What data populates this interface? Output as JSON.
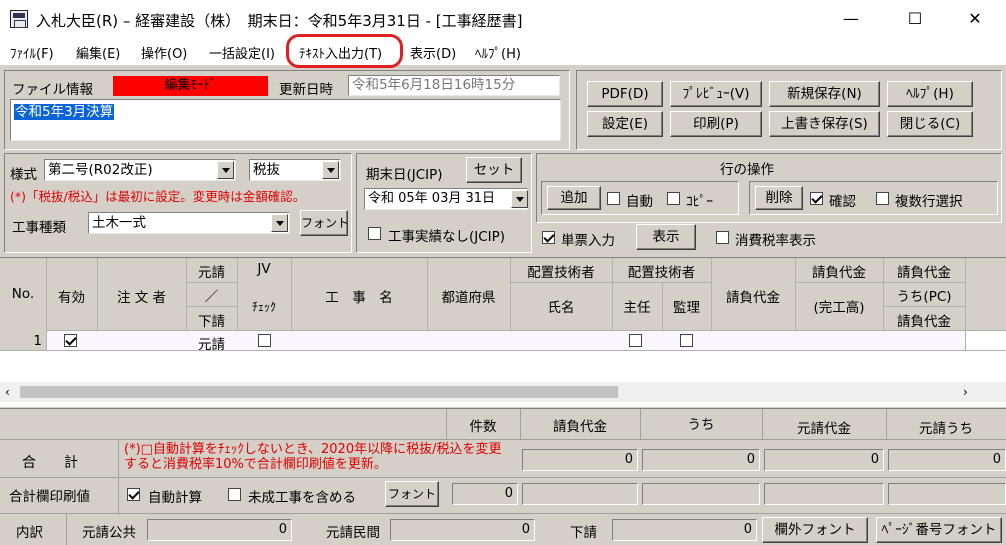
{
  "window": {
    "title": "入札大臣(R) – 経審建設（株）　期末日：令和5年3月31日 - [工事経歴書]",
    "minimize": "—",
    "maximize": "☐",
    "close": "✕"
  },
  "menu": [
    "ﾌｧｲﾙ(F)",
    "編集(E)",
    "操作(O)",
    "一括設定(I)",
    "ﾃｷｽﾄ入出力(T)",
    "表示(D)",
    "ﾍﾙﾌﾟ(H)"
  ],
  "file_info": {
    "label": "ファイル情報",
    "mode_badge": "編集ﾓｰﾄﾞ",
    "updated_label": "更新日時",
    "updated_value": "令和5年6月18日16時15分",
    "name_value": "令和5年3月決算",
    "badge_color": "#ff0000"
  },
  "buttons": {
    "pdf": "PDF(D)",
    "preview": "ﾌﾟﾚﾋﾞｭｰ(V)",
    "new_save": "新規保存(N)",
    "help": "ﾍﾙﾌﾟ(H)",
    "settings": "設定(E)",
    "print": "印刷(P)",
    "overwrite_save": "上書き保存(S)",
    "close": "閉じる(C)"
  },
  "form": {
    "style_label": "様式",
    "style_value": "第二号(R02改正)",
    "tax_value": "税抜",
    "tax_note": "(*)「税抜/税込」は最初に設定。変更時は金額確認。",
    "kind_label": "工事種類",
    "kind_value": "土木一式",
    "font_btn": "フォント"
  },
  "period": {
    "label": "期末日(JCIP)",
    "set_btn": "セット",
    "date_value": "令和 05年 03月 31日",
    "no_record_label": "工事実績なし(JCIP)"
  },
  "row_ops": {
    "title": "行の操作",
    "add": "追加",
    "auto": "自動",
    "copy": "ｺﾋﾟｰ",
    "delete": "削除",
    "confirm": "確認",
    "multi": "複数行選択",
    "single_entry": "単票入力",
    "show": "表示",
    "tax_rate_show": "消費税率表示"
  },
  "table": {
    "headers": {
      "no": "No.",
      "valid": "有効",
      "orderer": "注 文 者",
      "prime_top": "元請",
      "slash": "／",
      "sub": "下請",
      "jv": "JV",
      "jv_check": "ﾁｪｯｸ",
      "work_name": "工　事　名",
      "pref": "都道府県",
      "eng_top": "配置技術者",
      "eng_name": "氏名",
      "eng2_top": "配置技術者",
      "chief": "主任",
      "supervisor": "監理",
      "contract": "請負代金",
      "contract2_top": "請負代金",
      "contract2_bottom": "(完工高)",
      "contract3_top": "請負代金",
      "contract3_mid": "うち(PC)",
      "contract3_bottom": "請負代金"
    },
    "rows": [
      {
        "no": "1",
        "valid": true,
        "prime": "元請"
      }
    ]
  },
  "summary": {
    "headers": {
      "count": "件数",
      "contract": "請負代金",
      "uchi": "うち",
      "prime_contract": "元請代金",
      "prime_uchi": "元請うち"
    },
    "total_label": "合　　計",
    "note": "(*)□自動計算をﾁｪｯｸしないとき、2020年以降に税抜/税込を変更すると消費税率10%で合計欄印刷値を更新。",
    "print_label": "合計欄印刷値",
    "auto_calc": "自動計算",
    "incl_unfinished": "未成工事を含める",
    "font_btn": "フォント",
    "values": [
      "0",
      "0",
      "0",
      "0",
      "0"
    ]
  },
  "breakdown": {
    "label": "内訳",
    "public_label": "元請公共",
    "public_value": "0",
    "private_label": "元請民間",
    "private_value": "0",
    "sub_label": "下請",
    "sub_value": "0",
    "outside_font": "欄外フォント",
    "page_font": "ﾍﾟｰｼﾞ番号フォント"
  }
}
